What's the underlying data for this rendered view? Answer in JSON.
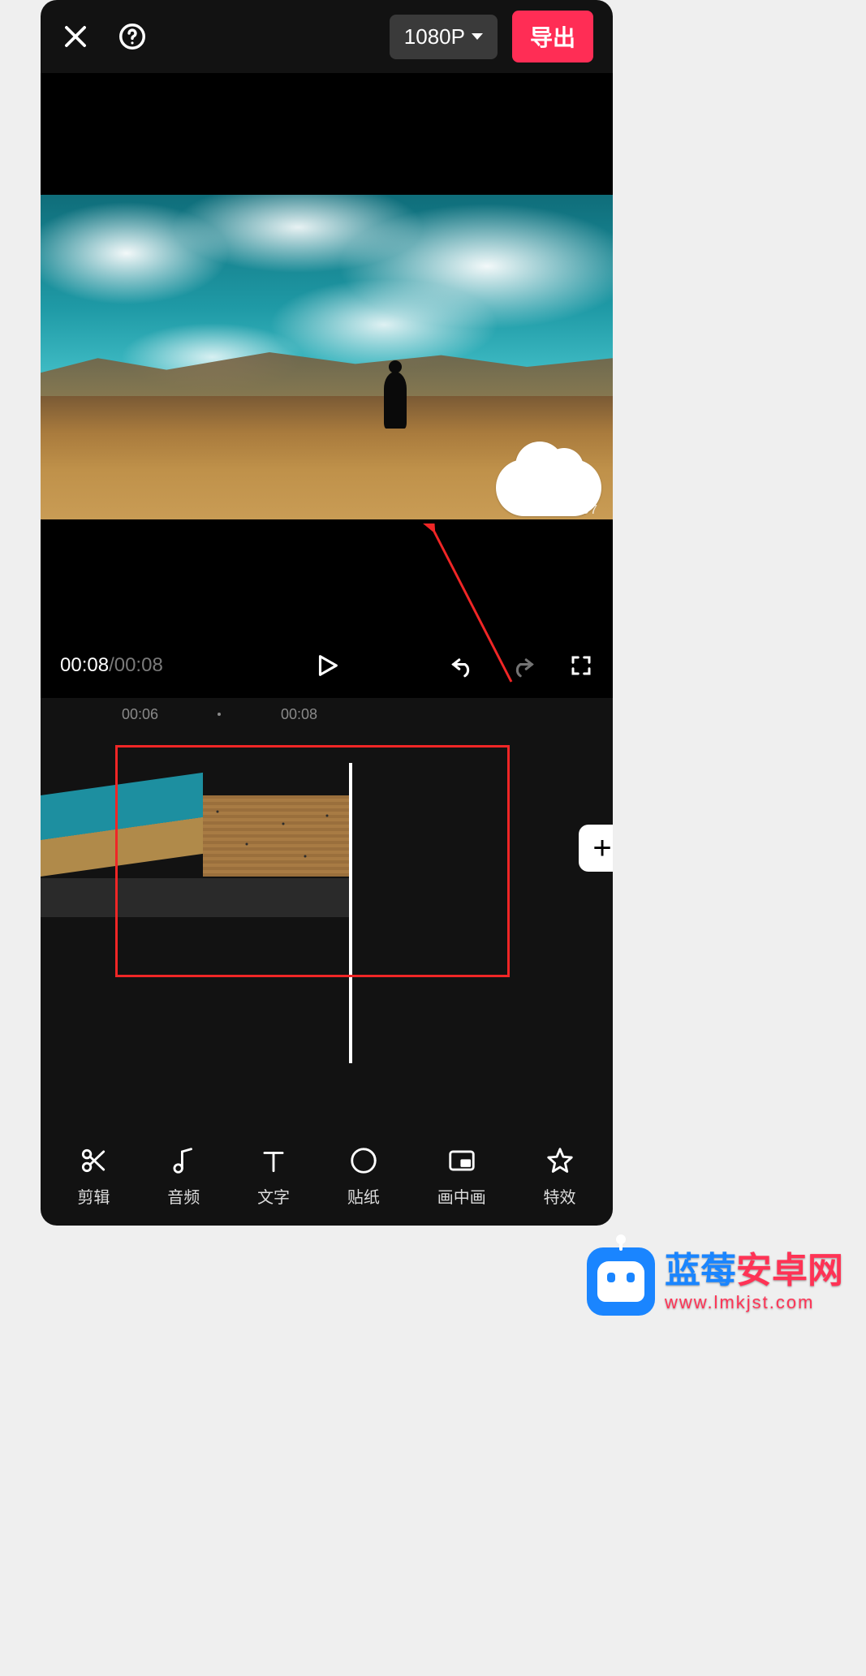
{
  "header": {
    "resolution_label": "1080P",
    "export_label": "导出"
  },
  "preview": {
    "watermark_text": "vWv97"
  },
  "controls": {
    "current_time": "00:08",
    "separator": " / ",
    "total_time": "00:08"
  },
  "ruler": {
    "tick1": "00:06",
    "tick2": "00:08"
  },
  "timeline": {
    "add_label": "+"
  },
  "toolbar": {
    "items": [
      {
        "label": "剪辑",
        "icon": "scissors-icon"
      },
      {
        "label": "音频",
        "icon": "music-note-icon"
      },
      {
        "label": "文字",
        "icon": "text-icon"
      },
      {
        "label": "贴纸",
        "icon": "sticker-icon"
      },
      {
        "label": "画中画",
        "icon": "pip-icon"
      },
      {
        "label": "特效",
        "icon": "effects-icon"
      }
    ]
  },
  "watermark": {
    "brand_blue": "蓝莓",
    "brand_red": "安卓网",
    "url": "www.lmkjst.com"
  }
}
